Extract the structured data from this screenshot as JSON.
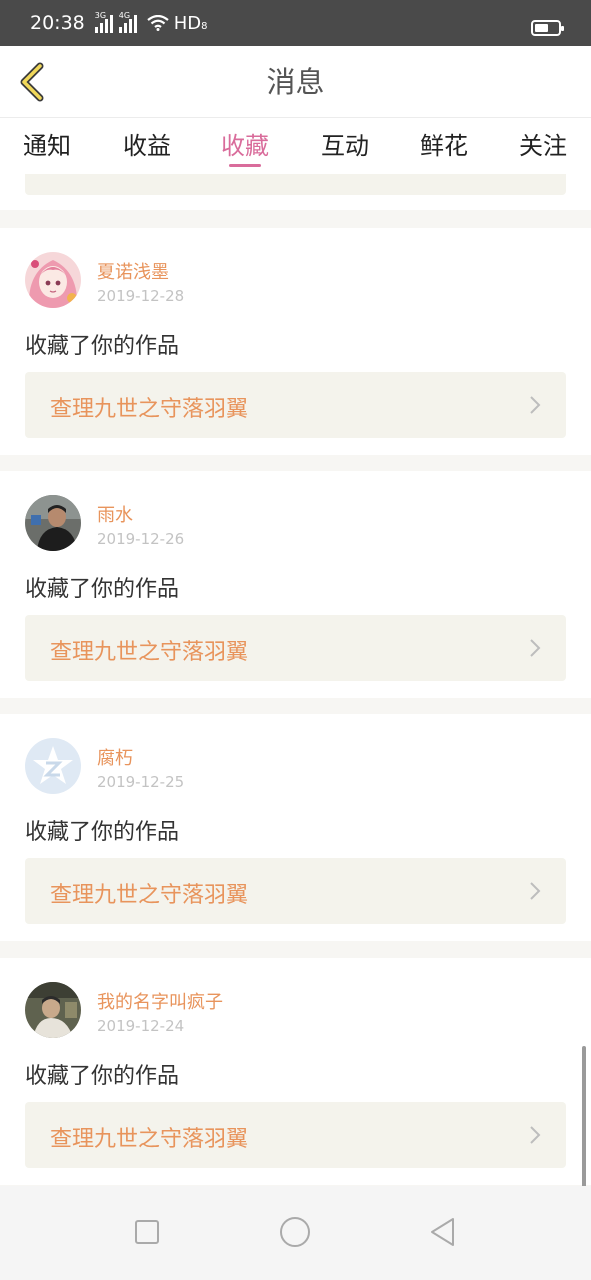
{
  "status_bar": {
    "time": "20:38",
    "signal1_label": "3G",
    "signal2_label": "4G",
    "network": "HD",
    "network_sub": "8"
  },
  "header": {
    "title": "消息",
    "back_icon": "back-chevron-icon"
  },
  "tabs": [
    {
      "label": "通知",
      "active": false
    },
    {
      "label": "收益",
      "active": false
    },
    {
      "label": "收藏",
      "active": true
    },
    {
      "label": "互动",
      "active": false
    },
    {
      "label": "鲜花",
      "active": false
    },
    {
      "label": "关注",
      "active": false
    }
  ],
  "items": [
    {
      "username": "夏诺浅墨",
      "date": "2019-12-28",
      "action": "收藏了你的作品",
      "work": "查理九世之守落羽翼",
      "avatar": "anime-girl-avatar"
    },
    {
      "username": "雨水",
      "date": "2019-12-26",
      "action": "收藏了你的作品",
      "work": "查理九世之守落羽翼",
      "avatar": "photo-avatar"
    },
    {
      "username": "腐朽",
      "date": "2019-12-25",
      "action": "收藏了你的作品",
      "work": "查理九世之守落羽翼",
      "avatar": "default-star-avatar"
    },
    {
      "username": "我的名字叫疯子",
      "date": "2019-12-24",
      "action": "收藏了你的作品",
      "work": "查理九世之守落羽翼",
      "avatar": "photo-avatar"
    }
  ],
  "colors": {
    "accent": "#d96c9b",
    "username": "#e8945c",
    "link_bg": "#f4f3ec"
  },
  "nav": {
    "recent_icon": "square-icon",
    "home_icon": "circle-icon",
    "back_icon": "triangle-back-icon"
  }
}
